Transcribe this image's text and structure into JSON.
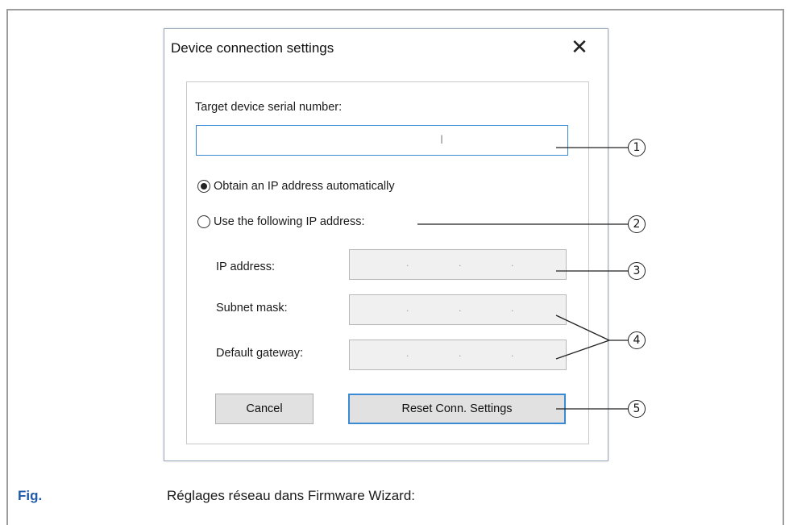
{
  "dialog": {
    "title": "Device connection settings",
    "close_glyph": "✕",
    "serial_label": "Target device serial number:",
    "serial_value": "",
    "radio_auto_label": "Obtain an IP address automatically",
    "radio_auto_selected": true,
    "radio_manual_label": "Use the following IP address:",
    "radio_manual_selected": false,
    "ip_label": "IP address:",
    "subnet_label": "Subnet mask:",
    "gateway_label": "Default gateway:",
    "ip_dots": ".",
    "cancel_label": "Cancel",
    "reset_label": "Reset Conn. Settings"
  },
  "callouts": [
    "1",
    "2",
    "3",
    "4",
    "5"
  ],
  "caption": {
    "fig_label": "Fig.",
    "text": "Réglages réseau dans Firmware Wizard:"
  },
  "colors": {
    "focus_border": "#3a8ad4",
    "caption_accent": "#1e5aa8"
  }
}
